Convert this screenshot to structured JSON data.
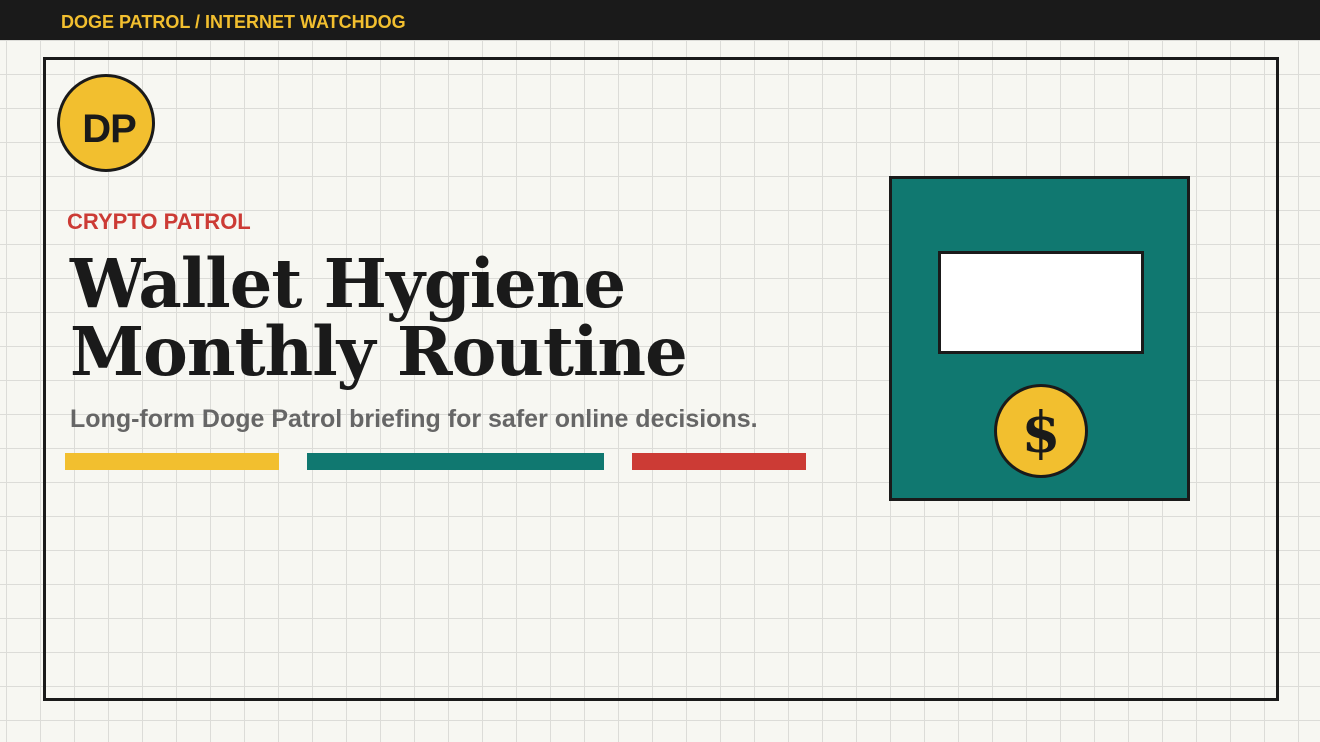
{
  "header": {
    "brand_line": "DOGE PATROL / INTERNET WATCHDOG"
  },
  "logo": {
    "initials": "DP"
  },
  "hero": {
    "kicker": "CRYPTO PATROL",
    "title_line1": "Wallet Hygiene",
    "title_line2": "Monthly Routine",
    "subtitle": "Long-form Doge Patrol briefing for safer online decisions."
  },
  "illustration": {
    "coin_symbol": "$",
    "icon": "wallet-coin-icon"
  },
  "colors": {
    "accent_yellow": "#f2bf2f",
    "accent_teal": "#107870",
    "accent_red": "#cc3b35",
    "ink": "#1a1a1a",
    "background": "#f7f7f2"
  }
}
